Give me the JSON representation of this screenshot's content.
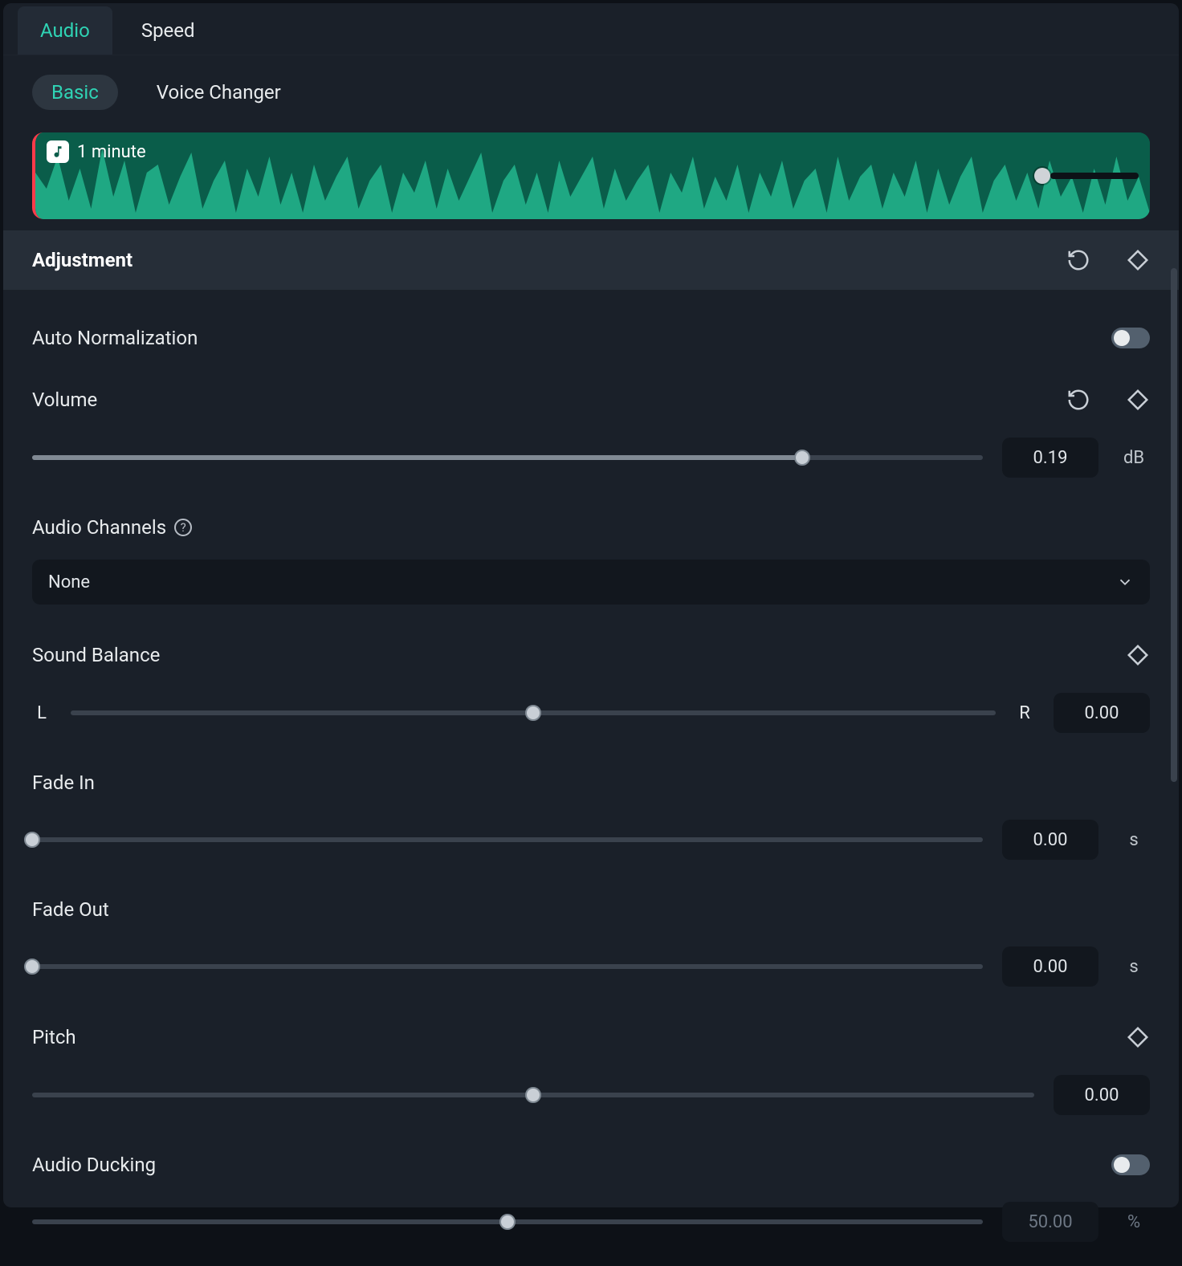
{
  "colors": {
    "accent": "#2fd4b5",
    "bg": "#1a2029",
    "track": "#3a424d"
  },
  "topTabs": {
    "audio": "Audio",
    "speed": "Speed",
    "active": "audio"
  },
  "subTabs": {
    "basic": "Basic",
    "voiceChanger": "Voice Changer",
    "active": "basic"
  },
  "clip": {
    "name": "1 minute",
    "trimPercent": 90
  },
  "section": {
    "title": "Adjustment"
  },
  "autoNormalize": {
    "label": "Auto Normalization",
    "on": false
  },
  "volume": {
    "label": "Volume",
    "value": "0.19",
    "unit": "dB",
    "percent": 81
  },
  "audioChannels": {
    "label": "Audio Channels",
    "value": "None"
  },
  "soundBalance": {
    "label": "Sound Balance",
    "left": "L",
    "right": "R",
    "value": "0.00",
    "percent": 50
  },
  "fadeIn": {
    "label": "Fade In",
    "value": "0.00",
    "unit": "s",
    "percent": 0
  },
  "fadeOut": {
    "label": "Fade Out",
    "value": "0.00",
    "unit": "s",
    "percent": 0
  },
  "pitch": {
    "label": "Pitch",
    "value": "0.00",
    "percent": 50
  },
  "ducking": {
    "label": "Audio Ducking",
    "on": false,
    "value": "50.00",
    "unit": "%",
    "percent": 50
  }
}
